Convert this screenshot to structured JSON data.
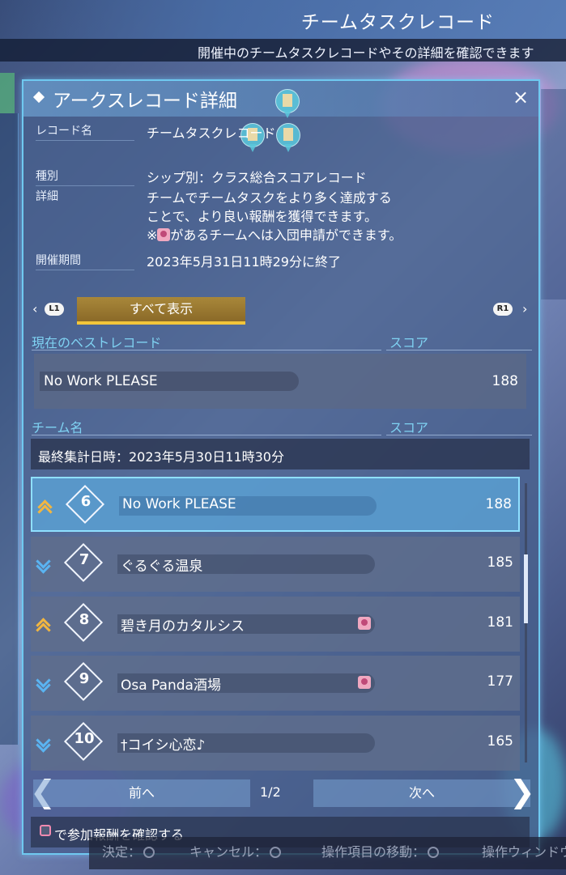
{
  "header": {
    "title": "チームタスクレコード",
    "subtitle": "開催中のチームタスクレコードやその詳細を確認できます"
  },
  "panel": {
    "title": "アークスレコード詳細",
    "close_label": "×",
    "fields": {
      "record_name_label": "レコード名",
      "record_name": "チームタスクレコード",
      "type_label": "種別",
      "type": "シップ別：クラス総合スコアレコード",
      "detail_label": "詳細",
      "detail_line1": "チームでチームタスクをより多く達成する",
      "detail_line2": "ことで、より良い報酬を獲得できます。",
      "detail_line3_prefix": "※",
      "detail_line3_suffix": "があるチームへは入団申請ができます。",
      "period_label": "開催期間",
      "period": "2023年5月31日11時29分に終了"
    },
    "filter": {
      "l1": "L1",
      "r1": "R1",
      "show_all": "すべて表示"
    },
    "best": {
      "header": "現在のベストレコード",
      "score_header": "スコア",
      "name": "No Work PLEASE",
      "score": "188"
    },
    "team": {
      "header": "チーム名",
      "score_header": "スコア"
    },
    "last_aggregate": "最終集計日時：2023年5月30日11時30分",
    "rows": [
      {
        "rank": "6",
        "trend": "up",
        "name": "No Work PLEASE",
        "score": "188",
        "recruiting": false,
        "selected": true
      },
      {
        "rank": "7",
        "trend": "down",
        "name": "ぐるぐる温泉",
        "score": "185",
        "recruiting": false,
        "selected": false
      },
      {
        "rank": "8",
        "trend": "up",
        "name": "碧き月のカタルシス",
        "score": "181",
        "recruiting": true,
        "selected": false
      },
      {
        "rank": "9",
        "trend": "down",
        "name": "Osa Panda酒場",
        "score": "177",
        "recruiting": true,
        "selected": false
      },
      {
        "rank": "10",
        "trend": "down",
        "name": "†コイシ心恋♪",
        "score": "165",
        "recruiting": false,
        "selected": false
      }
    ],
    "pagination": {
      "prev": "前へ",
      "next": "次へ",
      "page": "1/2"
    },
    "reward_hint": "で参加報酬を確認する"
  },
  "hints": {
    "decide": "決定：",
    "cancel": "キャンセル：",
    "move": "操作項目の移動：",
    "window": "操作ウィンドウ"
  },
  "colors": {
    "accent": "#6fc9f0",
    "gold": "#f2c53a",
    "up": "#f2b640",
    "down": "#5ab4f2"
  },
  "icons": {
    "trend_up": "chevron-double-up-icon",
    "trend_down": "chevron-double-down-icon",
    "recruiting": "join-request-icon"
  }
}
